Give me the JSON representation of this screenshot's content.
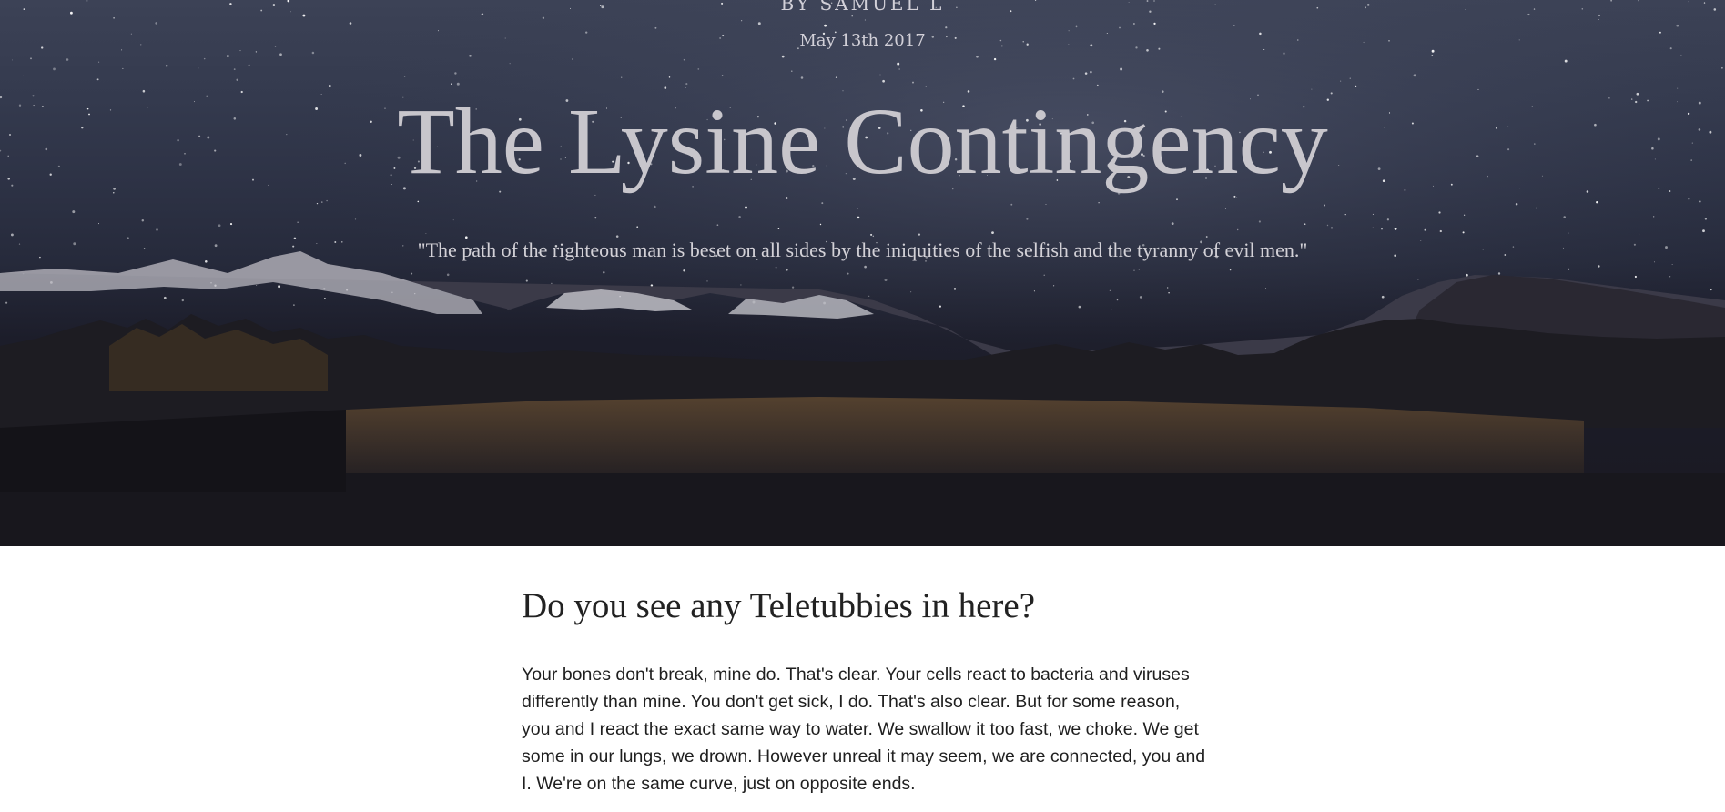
{
  "hero": {
    "byline": "BY SAMUEL L",
    "date": "May 13th 2017",
    "title": "The Lysine Contingency",
    "subtitle": "\"The path of the righteous man is beset on all sides by the iniquities of the selfish and the tyranny of evil men.\""
  },
  "article": {
    "heading": "Do you see any Teletubbies in here?",
    "paragraph": "Your bones don't break, mine do. That's clear. Your cells react to bacteria and viruses differently than mine. You don't get sick, I do. That's also clear. But for some reason, you and I react the exact same way to water. We swallow it too fast, we choke. We get some in our lungs, we drown. However unreal it may seem, we are connected, you and I. We're on the same curve, just on opposite ends."
  }
}
